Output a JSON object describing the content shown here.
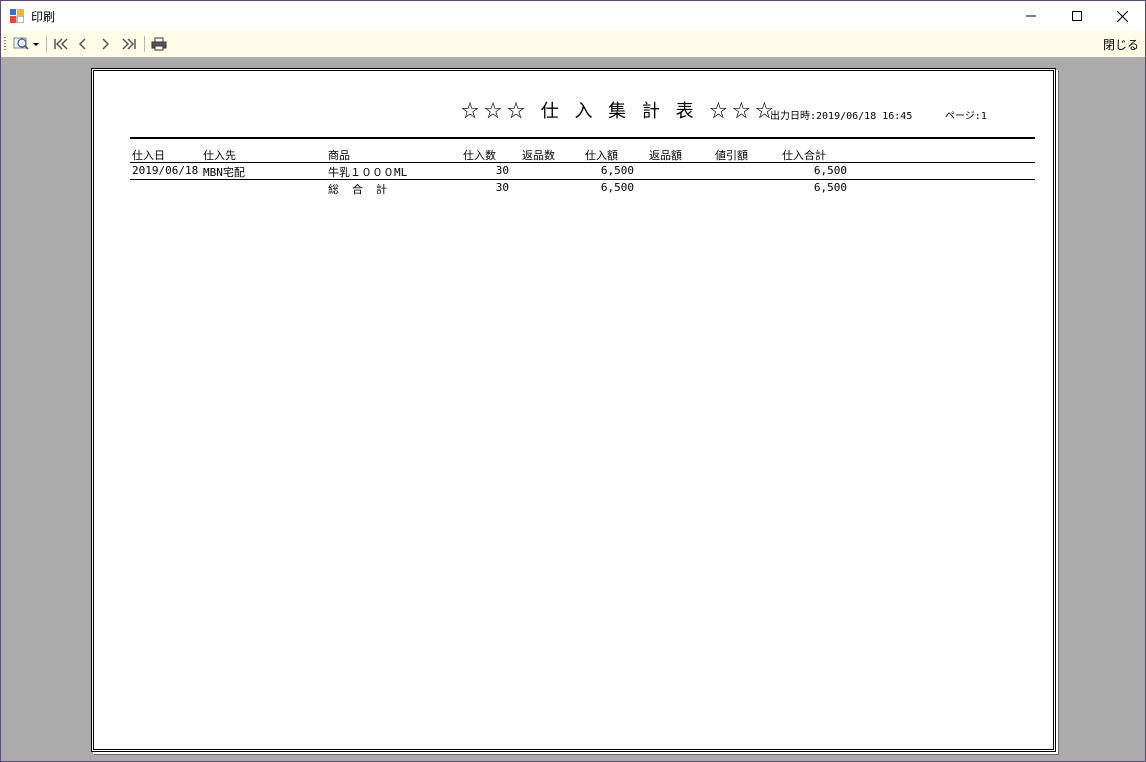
{
  "window": {
    "title": "印刷"
  },
  "toolbar": {
    "close_label": "閉じる",
    "icons": [
      "zoom-icon",
      "first-page-icon",
      "previous-page-icon",
      "next-page-icon",
      "last-page-icon",
      "printer-icon"
    ]
  },
  "report": {
    "title": "☆☆☆ 仕 入 集 計 表 ☆☆☆",
    "output_datetime": "出力日時:2019/06/18 16:45",
    "page": "ページ:1",
    "columns": [
      "仕入日",
      "仕入先",
      "商品",
      "仕入数",
      "返品数",
      "仕入額",
      "返品額",
      "値引額",
      "仕入合計"
    ],
    "rows": [
      {
        "date": "2019/06/18",
        "supplier": "MBN宅配",
        "product": "牛乳１０００ML",
        "qty": "30",
        "return_qty": "",
        "amount": "6,500",
        "return_amount": "",
        "discount": "",
        "total": "6,500"
      }
    ],
    "grand_total": {
      "label": "総　合　計",
      "qty": "30",
      "amount": "6,500",
      "total": "6,500"
    }
  }
}
